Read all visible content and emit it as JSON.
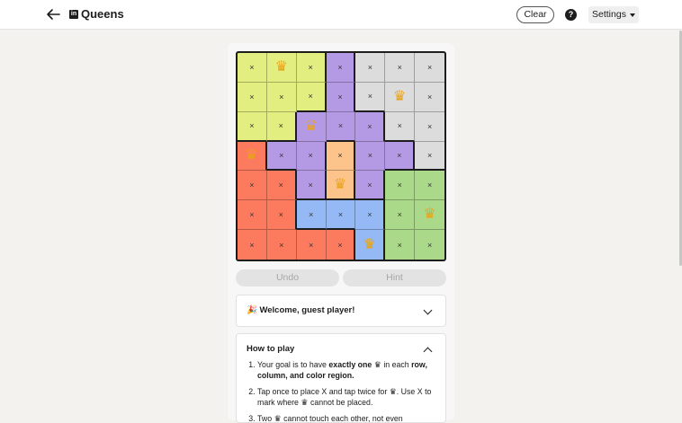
{
  "header": {
    "app_name": "Queens",
    "clear_label": "Clear",
    "help_symbol": "?",
    "settings_label": "Settings"
  },
  "board": {
    "size": 7,
    "regions": [
      [
        "yellow",
        "yellow",
        "yellow",
        "purple",
        "gray",
        "gray",
        "gray"
      ],
      [
        "yellow",
        "yellow",
        "yellow",
        "purple",
        "gray",
        "gray",
        "gray"
      ],
      [
        "yellow",
        "yellow",
        "purple",
        "purple",
        "purple",
        "gray",
        "gray"
      ],
      [
        "red",
        "purple",
        "purple",
        "peach",
        "purple",
        "purple",
        "gray"
      ],
      [
        "red",
        "red",
        "purple",
        "peach",
        "purple",
        "green",
        "green"
      ],
      [
        "red",
        "red",
        "blue",
        "blue",
        "blue",
        "green",
        "green"
      ],
      [
        "red",
        "red",
        "red",
        "red",
        "blue",
        "green",
        "green"
      ]
    ],
    "marks": [
      [
        "x",
        "queen",
        "x",
        "x",
        "x",
        "x",
        "x"
      ],
      [
        "x",
        "x",
        "x",
        "x",
        "x",
        "queen",
        "x"
      ],
      [
        "x",
        "x",
        "queen",
        "x",
        "x",
        "x",
        "x"
      ],
      [
        "queen",
        "x",
        "x",
        "x",
        "x",
        "x",
        "x"
      ],
      [
        "x",
        "x",
        "x",
        "queen",
        "x",
        "x",
        "x"
      ],
      [
        "x",
        "x",
        "x",
        "x",
        "x",
        "x",
        "queen"
      ],
      [
        "x",
        "x",
        "x",
        "x",
        "queen",
        "x",
        "x"
      ]
    ],
    "x_symbol": "×",
    "queen_symbol": "♛",
    "colors": {
      "yellow": "#e2ee7f",
      "purple": "#b49ae4",
      "gray": "#dcdcdc",
      "red": "#fc7b5e",
      "peach": "#fcc38b",
      "green": "#aad98a",
      "blue": "#94b9f5",
      "queen": "#e8a318"
    }
  },
  "actions": {
    "undo_label": "Undo",
    "hint_label": "Hint"
  },
  "welcome": {
    "text": "🎉 Welcome, guest player!"
  },
  "how_to_play": {
    "title": "How to play",
    "rule1_pre": "Your goal is to have ",
    "rule1_bold": "exactly one",
    "rule1_mid": " in each ",
    "rule1_bold2": "row, column, and color region.",
    "rule2_pre": "Tap once to place X and tap twice for",
    "rule2_mid": ". Use X to mark where",
    "rule2_post": "cannot be placed.",
    "rule3_pre": "Two",
    "rule3_post": "cannot touch each other, not even"
  }
}
